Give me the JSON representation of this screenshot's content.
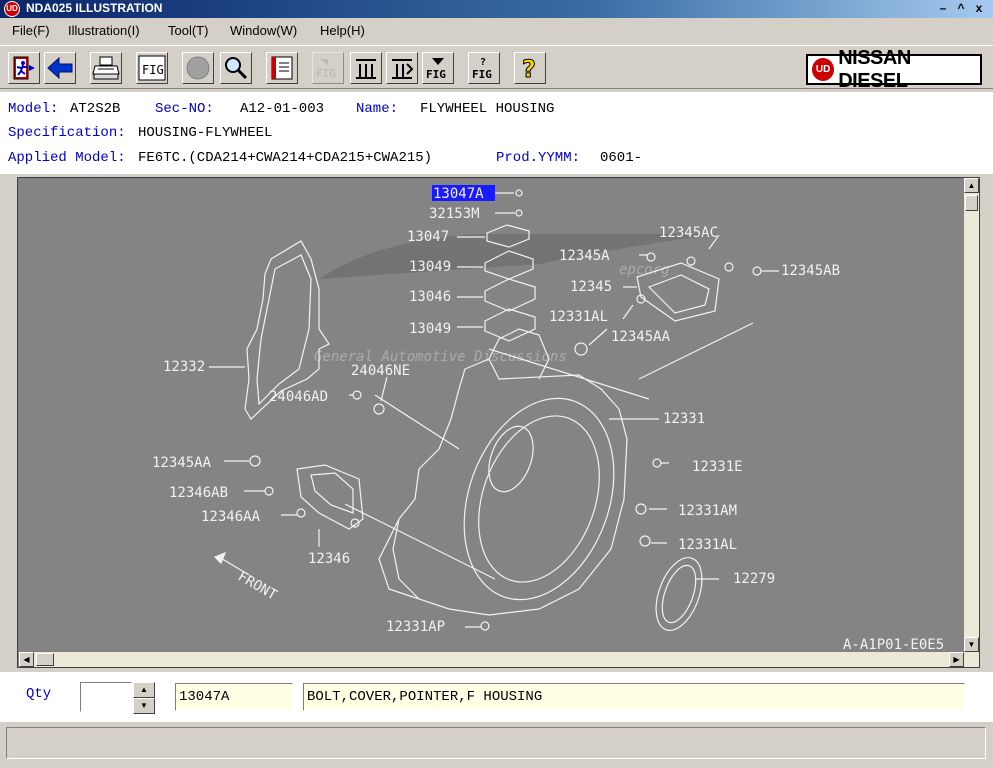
{
  "window": {
    "title": "NDA025 ILLUSTRATION",
    "app_icon": "UD",
    "controls": [
      "–",
      "^",
      "x"
    ]
  },
  "menu": {
    "items": [
      "File(F)",
      "Illustration(I)",
      "Tool(T)",
      "Window(W)",
      "Help(H)"
    ]
  },
  "toolbar": {
    "buttons": [
      {
        "name": "exit-icon",
        "label": ""
      },
      {
        "name": "back-arrow-icon",
        "label": ""
      },
      {
        "name": "printer-icon",
        "label": ""
      },
      {
        "name": "fig-icon",
        "label": "FIG"
      },
      {
        "name": "circle-icon",
        "label": ""
      },
      {
        "name": "magnifier-icon",
        "label": ""
      },
      {
        "name": "book-icon",
        "label": ""
      },
      {
        "name": "fig-prev-icon",
        "label": "FIG"
      },
      {
        "name": "index-first-icon",
        "label": ""
      },
      {
        "name": "index-next-icon",
        "label": ""
      },
      {
        "name": "fig-list-icon",
        "label": "FIG"
      },
      {
        "name": "fig-search-icon",
        "label": "FIG"
      },
      {
        "name": "help-icon",
        "label": "?"
      }
    ],
    "brand": {
      "ud": "UD",
      "text": "NISSAN DIESEL"
    }
  },
  "info": {
    "model_label": "Model:",
    "model": "AT2S2B",
    "secno_label": "Sec-NO:",
    "secno": "A12-01-003",
    "name_label": "Name:",
    "name": "FLYWHEEL HOUSING",
    "spec_label": "Specification:",
    "spec": "HOUSING-FLYWHEEL",
    "applied_label": "Applied Model:",
    "applied": "FE6TC.(CDA214+CWA214+CDA215+CWA215)",
    "prod_label": "Prod.YYMM:",
    "prod": "0601-"
  },
  "illustration": {
    "selected_callout": "13047A",
    "callouts": [
      "13047A",
      "32153M",
      "13047",
      "13049",
      "13046",
      "13049",
      "12345AC",
      "12345A",
      "12345AB",
      "12345",
      "12331AL",
      "12345AA",
      "12332",
      "24046NE",
      "24046AD",
      "12331",
      "12345AA",
      "12331E",
      "12346AB",
      "12346AA",
      "12331AM",
      "12346",
      "12331AL",
      "12279",
      "12331AP"
    ],
    "front_label": "FRONT",
    "figure_code": "A-A1P01-E0E5",
    "watermark": [
      "epcorg",
      "General Automotive Discussions"
    ]
  },
  "bottom": {
    "qty_label": "Qty",
    "qty_value": "",
    "part_number": "13047A",
    "part_description": "BOLT,COVER,POINTER,F HOUSING"
  },
  "colors": {
    "label_blue": "#0000cc",
    "canvas_gray": "#848484",
    "field_yellow": "#ffffe6"
  }
}
